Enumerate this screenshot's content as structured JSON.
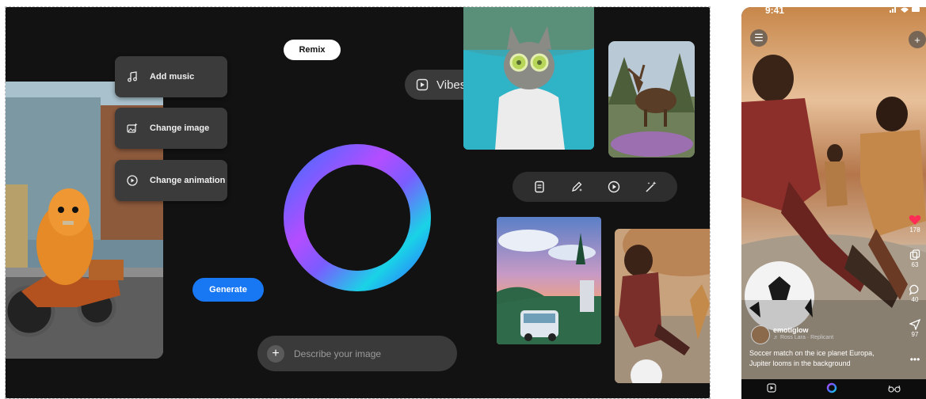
{
  "editor": {
    "menu": [
      {
        "label": "Add music",
        "icon": "music-note-icon"
      },
      {
        "label": "Change image",
        "icon": "image-sparkle-icon"
      },
      {
        "label": "Change animation",
        "icon": "play-circle-icon"
      }
    ],
    "remix_label": "Remix",
    "vibes_label": "Vibes",
    "generate_label": "Generate",
    "prompt_placeholder": "Describe your image",
    "toolbar_icons": [
      "document-icon",
      "pen-sparkle-icon",
      "play-circle-icon",
      "magic-wand-icon"
    ],
    "colors": {
      "background": "#121212",
      "accent_blue": "#1877f2",
      "ring_gradient": [
        "#b44dff",
        "#4a6bff",
        "#19d3e6"
      ]
    }
  },
  "phone": {
    "status_time": "9:41",
    "author": "emotiglow",
    "attribution": "♬ Ross Lara · Replicant",
    "caption_line1": "Soccer match on the ice planet Europa,",
    "caption_line2": "Jupiter looms in the background",
    "counts": {
      "likes": "178",
      "remixes": "63",
      "comments": "40",
      "shares": "97"
    },
    "nav_icons": [
      "play-square-icon",
      "meta-ai-ring-icon",
      "glasses-icon"
    ]
  }
}
